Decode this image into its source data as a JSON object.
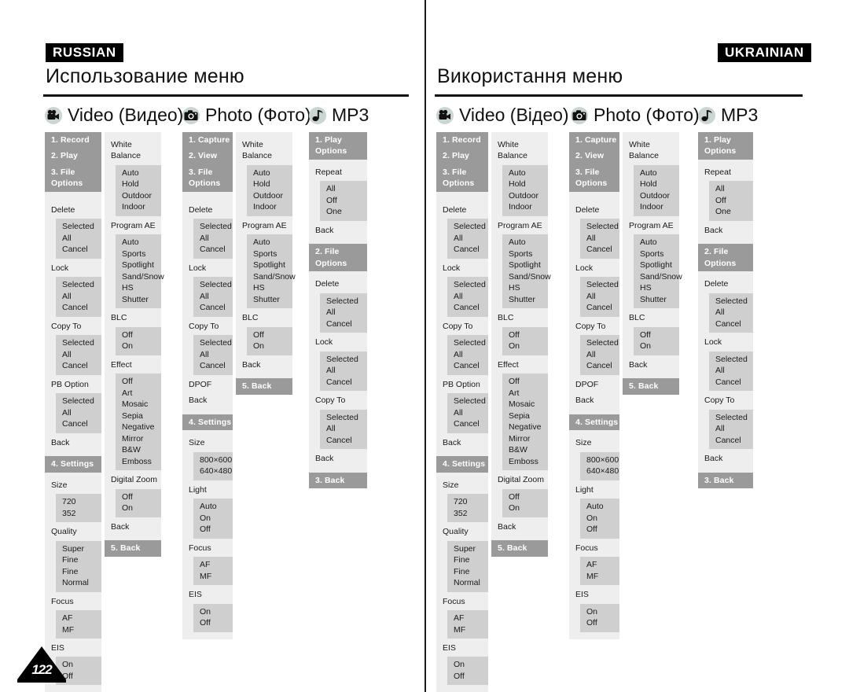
{
  "page": {
    "number": "122"
  },
  "panels": [
    {
      "id": "russian",
      "lang_tag": "RUSSIAN",
      "title": "Использование меню",
      "columns": [
        {
          "icon": "camcorder-icon",
          "label": "Video (Видео)"
        },
        {
          "icon": "camera-icon",
          "label": "Photo (Фото)"
        },
        {
          "icon": "music-note-icon",
          "label": "MP3"
        }
      ]
    },
    {
      "id": "ukrainian",
      "lang_tag": "UKRAINIAN",
      "title": "Використання меню",
      "columns": [
        {
          "icon": "camcorder-icon",
          "label": "Video (Відео)"
        },
        {
          "icon": "camera-icon",
          "label": "Photo (Фото)"
        },
        {
          "icon": "music-note-icon",
          "label": "MP3"
        }
      ]
    }
  ],
  "menus": {
    "video_main": [
      {
        "type": "hdr",
        "text": "1. Record"
      },
      {
        "type": "hdr",
        "text": "2. Play"
      },
      {
        "type": "hdr",
        "text": "3. File Options"
      },
      {
        "type": "spacer"
      },
      {
        "type": "glabel",
        "text": "Delete"
      },
      {
        "type": "opts",
        "items": [
          "Selected",
          "All",
          "Cancel"
        ]
      },
      {
        "type": "glabel",
        "text": "Lock"
      },
      {
        "type": "opts",
        "items": [
          "Selected",
          "All",
          "Cancel"
        ]
      },
      {
        "type": "glabel",
        "text": "Copy To"
      },
      {
        "type": "opts",
        "items": [
          "Selected",
          "All",
          "Cancel"
        ]
      },
      {
        "type": "glabel",
        "text": "PB Option"
      },
      {
        "type": "opts",
        "items": [
          "Selected",
          "All",
          "Cancel"
        ]
      },
      {
        "type": "glabel",
        "text": "Back"
      },
      {
        "type": "hdr",
        "text": "4. Settings"
      },
      {
        "type": "glabel",
        "text": "Size"
      },
      {
        "type": "opts",
        "items": [
          "720",
          "352"
        ]
      },
      {
        "type": "glabel",
        "text": "Quality"
      },
      {
        "type": "opts",
        "items": [
          "Super Fine",
          "Fine",
          "Normal"
        ]
      },
      {
        "type": "glabel",
        "text": "Focus"
      },
      {
        "type": "opts",
        "items": [
          "AF",
          "MF"
        ]
      },
      {
        "type": "glabel",
        "text": "EIS"
      },
      {
        "type": "opts",
        "items": [
          "On",
          "Off"
        ]
      }
    ],
    "video_sub": [
      {
        "type": "glabel",
        "text": "White Balance"
      },
      {
        "type": "opts",
        "items": [
          "Auto",
          "Hold",
          "Outdoor",
          "Indoor"
        ]
      },
      {
        "type": "glabel",
        "text": "Program AE"
      },
      {
        "type": "opts",
        "items": [
          "Auto",
          "Sports",
          "Spotlight",
          "Sand/Snow",
          "HS Shutter"
        ]
      },
      {
        "type": "glabel",
        "text": "BLC"
      },
      {
        "type": "opts",
        "items": [
          "Off",
          "On"
        ]
      },
      {
        "type": "glabel",
        "text": "Effect"
      },
      {
        "type": "opts",
        "items": [
          "Off",
          "Art",
          "Mosaic",
          "Sepia",
          "Negative",
          "Mirror",
          "B&W",
          "Emboss"
        ]
      },
      {
        "type": "glabel",
        "text": "Digital Zoom"
      },
      {
        "type": "opts",
        "items": [
          "Off",
          "On"
        ]
      },
      {
        "type": "glabel",
        "text": "Back"
      },
      {
        "type": "hdr",
        "text": "5. Back"
      }
    ],
    "photo_main": [
      {
        "type": "hdr",
        "text": "1. Capture"
      },
      {
        "type": "hdr",
        "text": "2. View"
      },
      {
        "type": "hdr",
        "text": "3. File Options"
      },
      {
        "type": "spacer"
      },
      {
        "type": "glabel",
        "text": "Delete"
      },
      {
        "type": "opts",
        "items": [
          "Selected",
          "All",
          "Cancel"
        ]
      },
      {
        "type": "glabel",
        "text": "Lock"
      },
      {
        "type": "opts",
        "items": [
          "Selected",
          "All",
          "Cancel"
        ]
      },
      {
        "type": "glabel",
        "text": "Copy To"
      },
      {
        "type": "opts",
        "items": [
          "Selected",
          "All",
          "Cancel"
        ]
      },
      {
        "type": "glabel",
        "text": "DPOF"
      },
      {
        "type": "glabel",
        "text": "Back"
      },
      {
        "type": "hdr",
        "text": "4. Settings"
      },
      {
        "type": "glabel",
        "text": "Size"
      },
      {
        "type": "opts",
        "items": [
          "800×600",
          "640×480"
        ]
      },
      {
        "type": "glabel",
        "text": "Light"
      },
      {
        "type": "opts",
        "items": [
          "Auto",
          "On",
          "Off"
        ]
      },
      {
        "type": "glabel",
        "text": "Focus"
      },
      {
        "type": "opts",
        "items": [
          "AF",
          "MF"
        ]
      },
      {
        "type": "glabel",
        "text": "EIS"
      },
      {
        "type": "opts",
        "items": [
          "On",
          "Off"
        ]
      }
    ],
    "photo_sub": [
      {
        "type": "glabel",
        "text": "White Balance"
      },
      {
        "type": "opts",
        "items": [
          "Auto",
          "Hold",
          "Outdoor",
          "Indoor"
        ]
      },
      {
        "type": "glabel",
        "text": "Program AE"
      },
      {
        "type": "opts",
        "items": [
          "Auto",
          "Sports",
          "Spotlight",
          "Sand/Snow",
          "HS Shutter"
        ]
      },
      {
        "type": "glabel",
        "text": "BLC"
      },
      {
        "type": "opts",
        "items": [
          "Off",
          "On"
        ]
      },
      {
        "type": "glabel",
        "text": "Back"
      },
      {
        "type": "hdr",
        "text": "5. Back"
      }
    ],
    "mp3_main": [
      {
        "type": "hdr",
        "text": "1. Play Options"
      },
      {
        "type": "glabel",
        "text": "Repeat"
      },
      {
        "type": "opts",
        "items": [
          "All",
          "Off",
          "One"
        ]
      },
      {
        "type": "glabel",
        "text": "Back"
      },
      {
        "type": "hdr",
        "text": "2. File Options"
      },
      {
        "type": "glabel",
        "text": "Delete"
      },
      {
        "type": "opts",
        "items": [
          "Selected",
          "All",
          "Cancel"
        ]
      },
      {
        "type": "glabel",
        "text": "Lock"
      },
      {
        "type": "opts",
        "items": [
          "Selected",
          "All",
          "Cancel"
        ]
      },
      {
        "type": "glabel",
        "text": "Copy To"
      },
      {
        "type": "opts",
        "items": [
          "Selected",
          "All",
          "Cancel"
        ]
      },
      {
        "type": "glabel",
        "text": "Back"
      },
      {
        "type": "hdr",
        "text": "3. Back"
      }
    ]
  },
  "colors": {
    "header_bar": "#9a9a9a",
    "light_panel": "#eeeeee",
    "option_block": "#cfcfcf",
    "ink": "#1a1a1a"
  }
}
